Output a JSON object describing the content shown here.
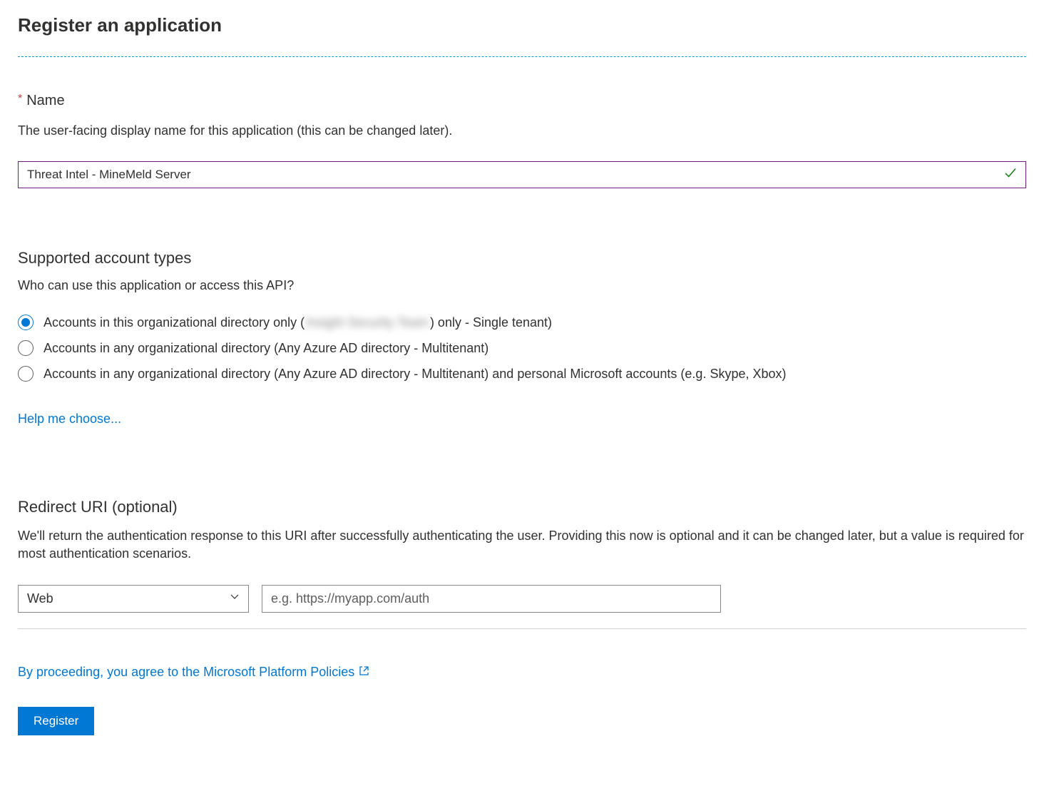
{
  "page": {
    "title": "Register an application"
  },
  "name_field": {
    "label": "Name",
    "description": "The user-facing display name for this application (this can be changed later).",
    "value": "Threat Intel - MineMeld Server"
  },
  "account_types": {
    "title": "Supported account types",
    "question": "Who can use this application or access this API?",
    "options": [
      {
        "label_prefix": "Accounts in this organizational directory only (",
        "label_blurred": "Insight Security Team",
        "label_suffix": ") only - Single tenant)",
        "selected": true
      },
      {
        "label": "Accounts in any organizational directory (Any Azure AD directory - Multitenant)",
        "selected": false
      },
      {
        "label": "Accounts in any organizational directory (Any Azure AD directory - Multitenant) and personal Microsoft accounts (e.g. Skype, Xbox)",
        "selected": false
      }
    ],
    "help_link": "Help me choose..."
  },
  "redirect_uri": {
    "title": "Redirect URI (optional)",
    "description": "We'll return the authentication response to this URI after successfully authenticating the user. Providing this now is optional and it can be changed later, but a value is required for most authentication scenarios.",
    "type_value": "Web",
    "uri_placeholder": "e.g. https://myapp.com/auth"
  },
  "footer": {
    "agreement_text": "By proceeding, you agree to the Microsoft Platform Policies",
    "register_button": "Register"
  }
}
